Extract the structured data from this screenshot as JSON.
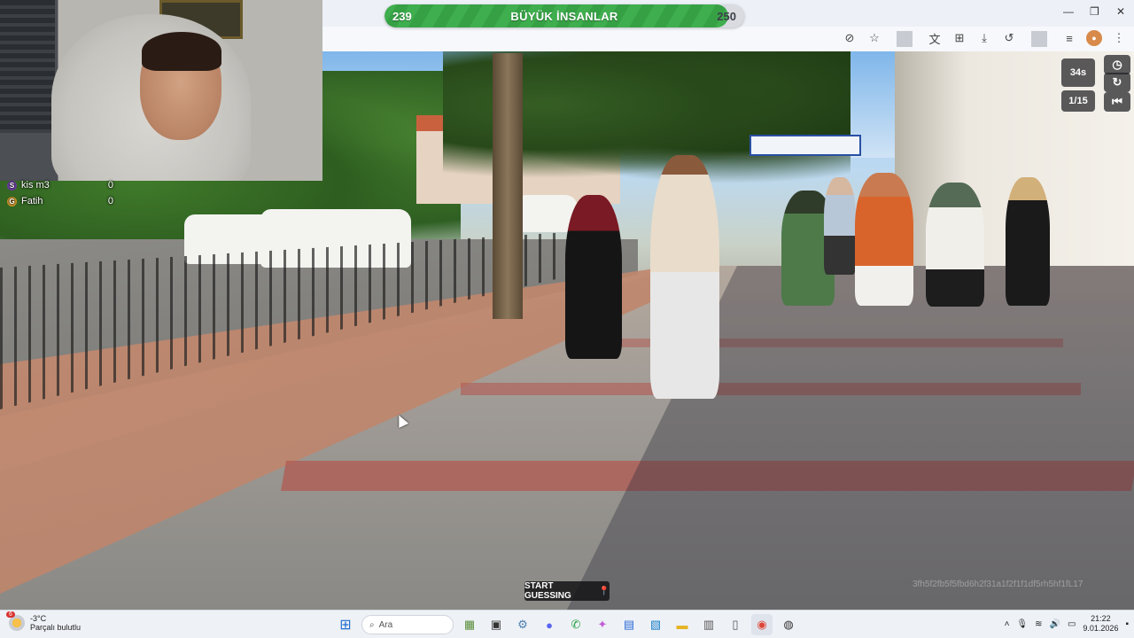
{
  "banner": {
    "current": "239",
    "title": "BÜYÜK İNSANLAR",
    "target": "250",
    "progress": 0.956
  },
  "game": {
    "timer": "34s",
    "round": "1/15",
    "start_guessing": "START GUESSING",
    "watermark": "3fh5f2fb5f5fbd6h2f31a1f2f1f1df5rh5hf1fL17"
  },
  "players": [
    {
      "initial": "S",
      "name": "kis m3",
      "score": "0",
      "color": "#6b3fa0"
    },
    {
      "initial": "G",
      "name": "Fatih",
      "score": "0",
      "color": "#d39a2a"
    }
  ],
  "browser": {
    "icons": [
      "eye-off-icon",
      "star-icon",
      "translate-icon",
      "extensions-icon",
      "download-icon",
      "history-icon",
      "media-icon",
      "profile-icon",
      "menu-icon"
    ]
  },
  "taskbar": {
    "weather_temp": "-3°C",
    "weather_desc": "Parçalı bulutlu",
    "weather_badge": "6",
    "search_placeholder": "Ara",
    "time": "21:22",
    "date": "9.01.2026"
  }
}
